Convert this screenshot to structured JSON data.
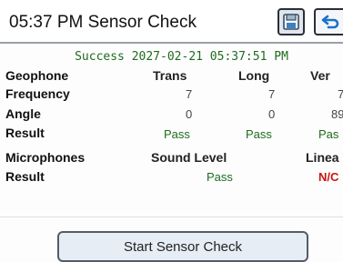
{
  "header": {
    "time": "05:37 PM",
    "title": "Sensor Check",
    "save_icon": "save-icon",
    "back_icon": "back-icon"
  },
  "status": "Success 2027-02-21 05:37:51 PM",
  "geophone": {
    "label": "Geophone",
    "columns": [
      "Trans",
      "Long",
      "Ver"
    ],
    "rows": [
      {
        "label": "Frequency",
        "values": [
          "7",
          "7",
          "7"
        ]
      },
      {
        "label": "Angle",
        "values": [
          "0",
          "0",
          "89"
        ]
      },
      {
        "label": "Result",
        "values": [
          "Pass",
          "Pass",
          "Pas"
        ]
      }
    ]
  },
  "microphones": {
    "label": "Microphones",
    "columns": [
      "Sound Level",
      "Linea"
    ],
    "result_label": "Result",
    "results": [
      "Pass",
      "N/C"
    ]
  },
  "actions": {
    "start_label": "Start Sensor Check"
  },
  "colors": {
    "pass": "#1f6b1f",
    "fail": "#cc1111",
    "button_bg": "#e6edf5"
  }
}
